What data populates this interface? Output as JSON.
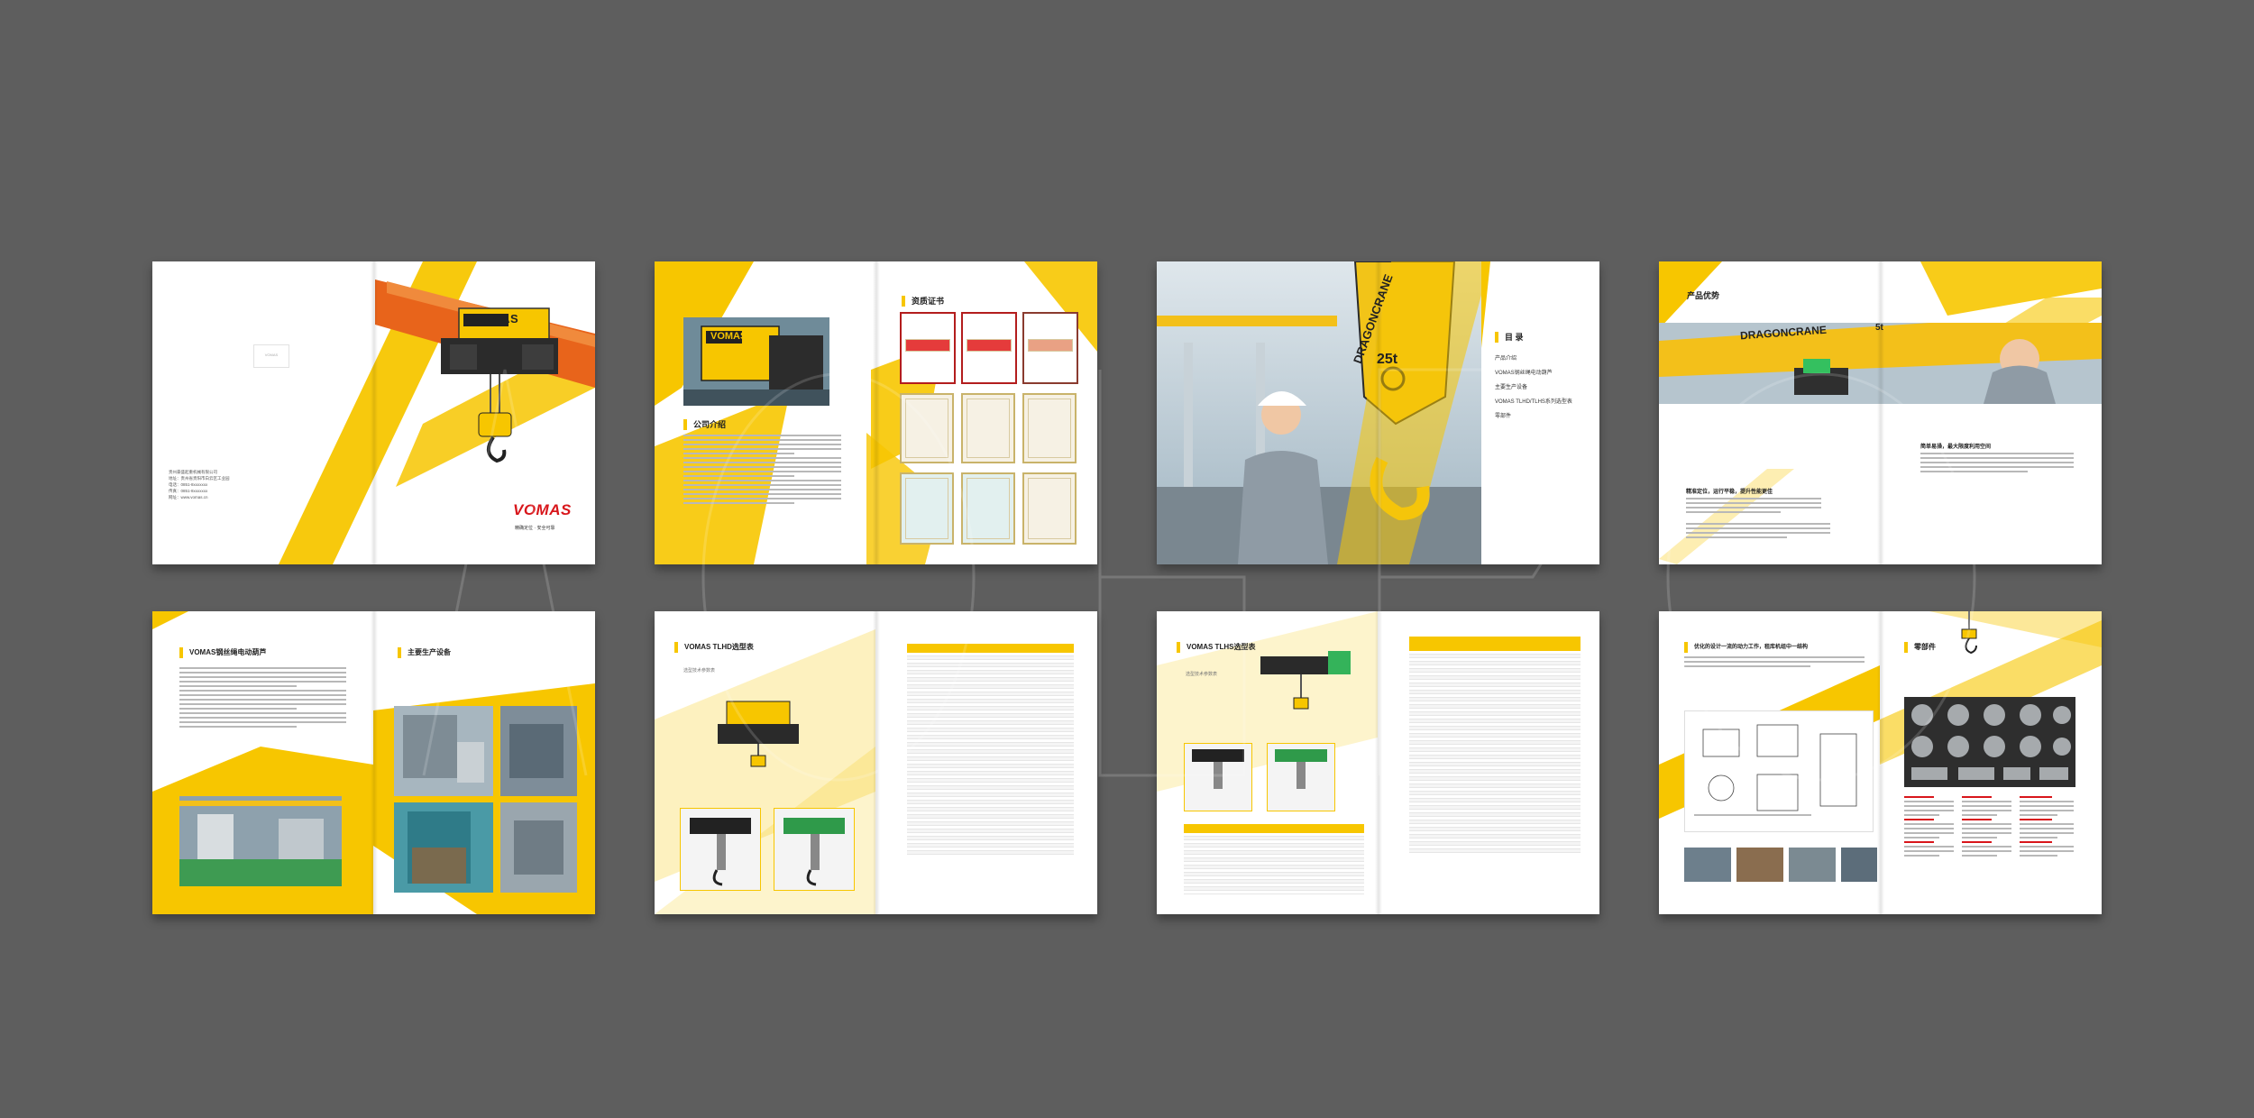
{
  "brand": "VOMAS",
  "brand_tagline": "精确定位 · 安全可靠",
  "crane_label": "DRAGONCRANE",
  "hook_rating": "25t",
  "beam_rating": "5t",
  "spreads": {
    "s1": {
      "logo_small": "VOMAS",
      "address_lines": [
        "贵州豪盛起重机械有限公司",
        "地址：贵州省贵阳市白云区工业园",
        "电话：0851-8xxxxxxx",
        "传真：0851-8xxxxxxx",
        "网址：www.vomas.cn"
      ]
    },
    "s2": {
      "title": "公司介绍",
      "cert_title": "资质证书"
    },
    "s3": {
      "title": "目 录",
      "toc": [
        "产品介绍",
        "VOMAS钢丝绳电动葫芦",
        "主要生产设备",
        "VOMAS TLHD/TLHS系列选型表",
        "零部件"
      ]
    },
    "s4": {
      "title": "产品优势",
      "feature_1": "精准定位，运行平稳，提升性能更佳",
      "feature_2": "简单易操，最大限度利用空间"
    },
    "s5": {
      "title": "VOMAS钢丝绳电动葫芦",
      "title_r": "主要生产设备"
    },
    "s6": {
      "title": "VOMAS TLHD选型表",
      "sub": "选型技术参数表"
    },
    "s7": {
      "title": "VOMAS TLHS选型表",
      "sub": "选型技术参数表"
    },
    "s8": {
      "title": "零部件",
      "left_title": "优化的设计一流的动力工作，租库机组中一结构"
    }
  },
  "colors": {
    "bg": "#5e5e5e",
    "yellow": "#f7c600",
    "orange": "#e8641b",
    "red": "#d8161b",
    "photo_blue": "#8fb3c9"
  }
}
